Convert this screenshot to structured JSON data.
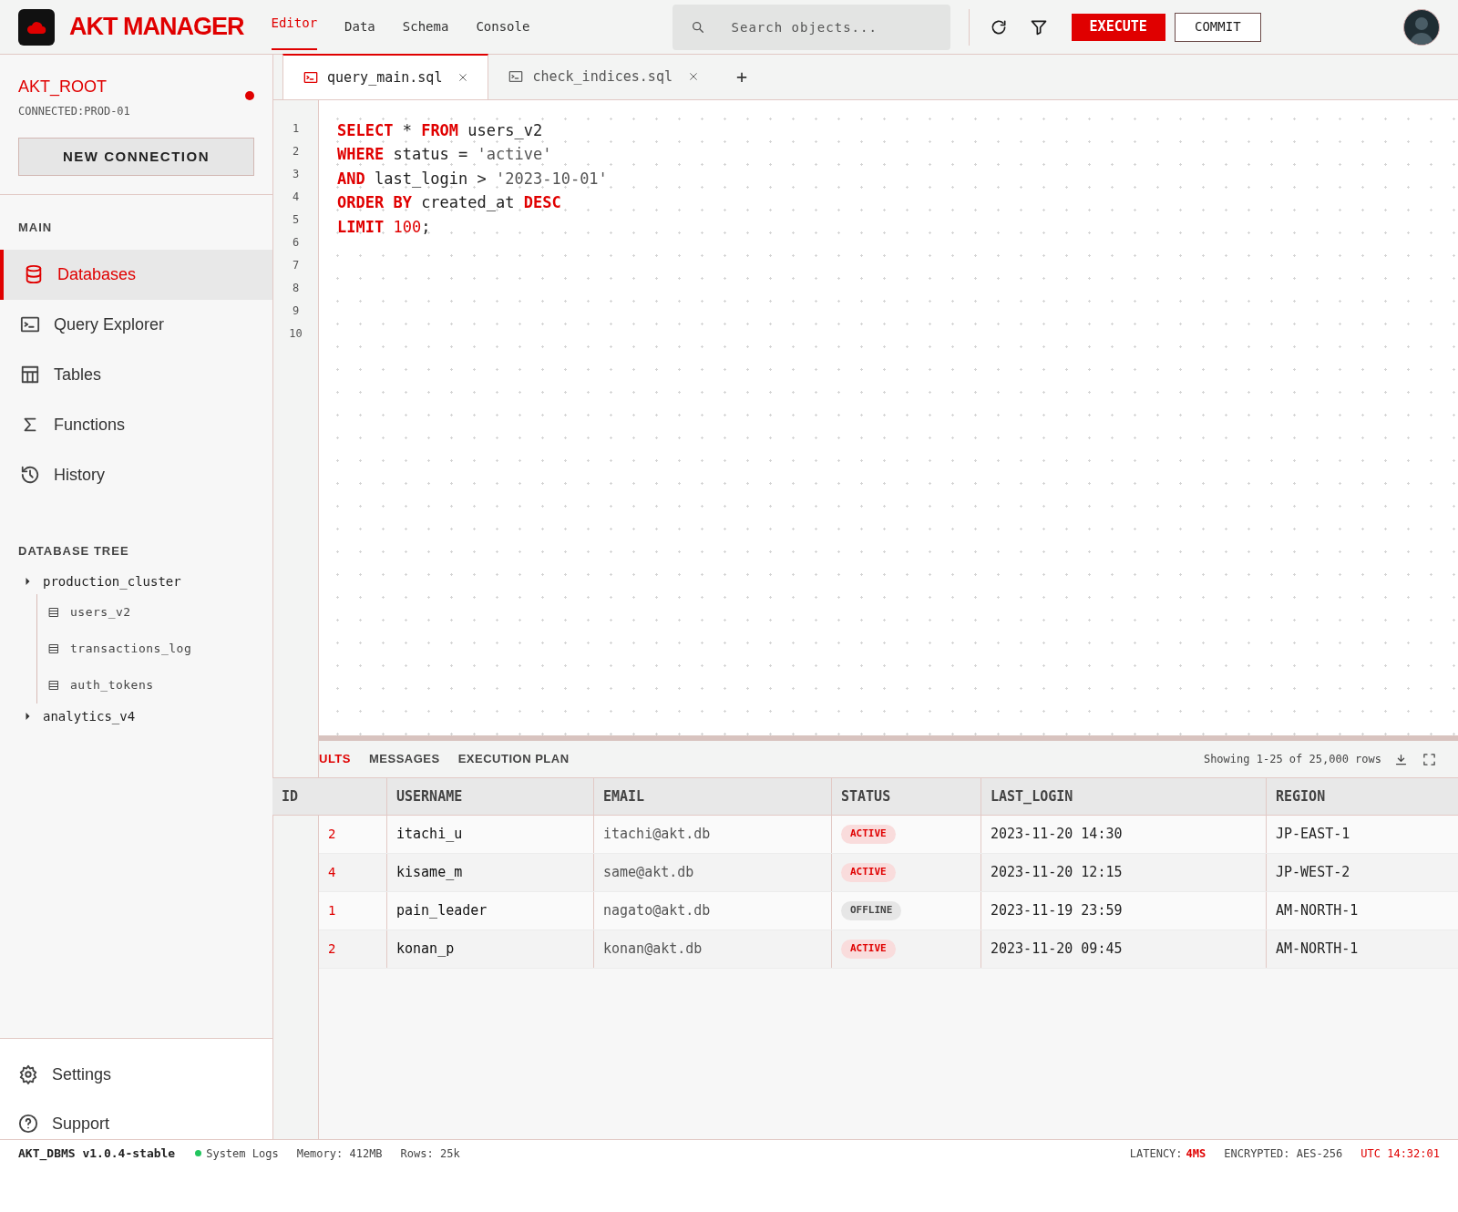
{
  "app": {
    "title": "AKT MANAGER"
  },
  "nav": [
    {
      "label": "Editor",
      "selected": true
    },
    {
      "label": "Data",
      "selected": false
    },
    {
      "label": "Schema",
      "selected": false
    },
    {
      "label": "Console",
      "selected": false
    }
  ],
  "search": {
    "placeholder": "Search objects..."
  },
  "actions": {
    "execute": "EXECUTE",
    "commit": "COMMIT"
  },
  "connection": {
    "user": "AKT_ROOT",
    "status": "CONNECTED:PROD-01",
    "online": true,
    "button": "NEW CONNECTION"
  },
  "sidebar": {
    "main_heading": "MAIN",
    "items": [
      {
        "label": "Databases",
        "selected": true
      },
      {
        "label": "Query Explorer",
        "selected": false
      },
      {
        "label": "Tables",
        "selected": false
      },
      {
        "label": "Functions",
        "selected": false
      },
      {
        "label": "History",
        "selected": false
      }
    ],
    "tree_heading": "DATABASE TREE",
    "tree": [
      {
        "label": "production_cluster",
        "children": [
          {
            "label": "users_v2"
          },
          {
            "label": "transactions_log"
          },
          {
            "label": "auth_tokens"
          }
        ]
      },
      {
        "label": "analytics_v4"
      }
    ],
    "footer_items": [
      {
        "label": "Settings"
      },
      {
        "label": "Support"
      }
    ]
  },
  "editor_tabs": [
    {
      "label": "query_main.sql",
      "selected": true
    },
    {
      "label": "check_indices.sql",
      "selected": false
    }
  ],
  "new_tab": "+",
  "code": {
    "line_numbers": [
      "1",
      "2",
      "3",
      "4",
      "5",
      "6",
      "7",
      "8",
      "9",
      "10"
    ],
    "lines": [
      [
        {
          "kind": "keyword",
          "text": "SELECT"
        },
        {
          "kind": "plain",
          "text": " * "
        },
        {
          "kind": "keyword",
          "text": "FROM"
        },
        {
          "kind": "plain",
          "text": " users_v2"
        }
      ],
      [
        {
          "kind": "keyword",
          "text": "WHERE"
        },
        {
          "kind": "plain",
          "text": " status = "
        },
        {
          "kind": "string",
          "text": "'active'"
        }
      ],
      [
        {
          "kind": "keyword",
          "text": "AND"
        },
        {
          "kind": "plain",
          "text": " last_login > "
        },
        {
          "kind": "string",
          "text": "'2023-10-01'"
        }
      ],
      [
        {
          "kind": "keyword",
          "text": "ORDER BY"
        },
        {
          "kind": "plain",
          "text": " created_at "
        },
        {
          "kind": "keyword",
          "text": "DESC"
        }
      ],
      [
        {
          "kind": "keyword",
          "text": "LIMIT"
        },
        {
          "kind": "number",
          "text": " 100"
        },
        {
          "kind": "plain",
          "text": ";"
        }
      ]
    ]
  },
  "results": {
    "tabs": [
      {
        "label": "ULTS",
        "selected": true
      },
      {
        "label": "MESSAGES",
        "selected": false
      },
      {
        "label": "EXECUTION PLAN",
        "selected": false
      }
    ],
    "summary": "Showing 1-25 of 25,000 rows",
    "columns": [
      "ID",
      "USERNAME",
      "EMAIL",
      "STATUS",
      "LAST_LOGIN",
      "REGION"
    ],
    "rows": [
      {
        "id": "2",
        "username": "itachi_u",
        "email": "itachi@akt.db",
        "status": "ACTIVE",
        "kind": "active",
        "last_login": "2023-11-20 14:30",
        "region": "JP-EAST-1"
      },
      {
        "id": "4",
        "username": "kisame_m",
        "email": "same@akt.db",
        "status": "ACTIVE",
        "kind": "active",
        "last_login": "2023-11-20 12:15",
        "region": "JP-WEST-2"
      },
      {
        "id": "1",
        "username": "pain_leader",
        "email": "nagato@akt.db",
        "status": "OFFLINE",
        "kind": "offline",
        "last_login": "2023-11-19 23:59",
        "region": "AM-NORTH-1"
      },
      {
        "id": "2",
        "username": "konan_p",
        "email": "konan@akt.db",
        "status": "ACTIVE",
        "kind": "active",
        "last_login": "2023-11-20 09:45",
        "region": "AM-NORTH-1"
      }
    ]
  },
  "status_bar": {
    "version": "AKT_DBMS v1.0.4-stable",
    "logs": "System Logs",
    "logs_online": true,
    "memory": "Memory: 412MB",
    "rows": "Rows: 25k",
    "latency_label": "LATENCY:",
    "latency_value": "4MS",
    "encryption": "ENCRYPTED: AES-256",
    "time": "UTC 14:32:01"
  }
}
